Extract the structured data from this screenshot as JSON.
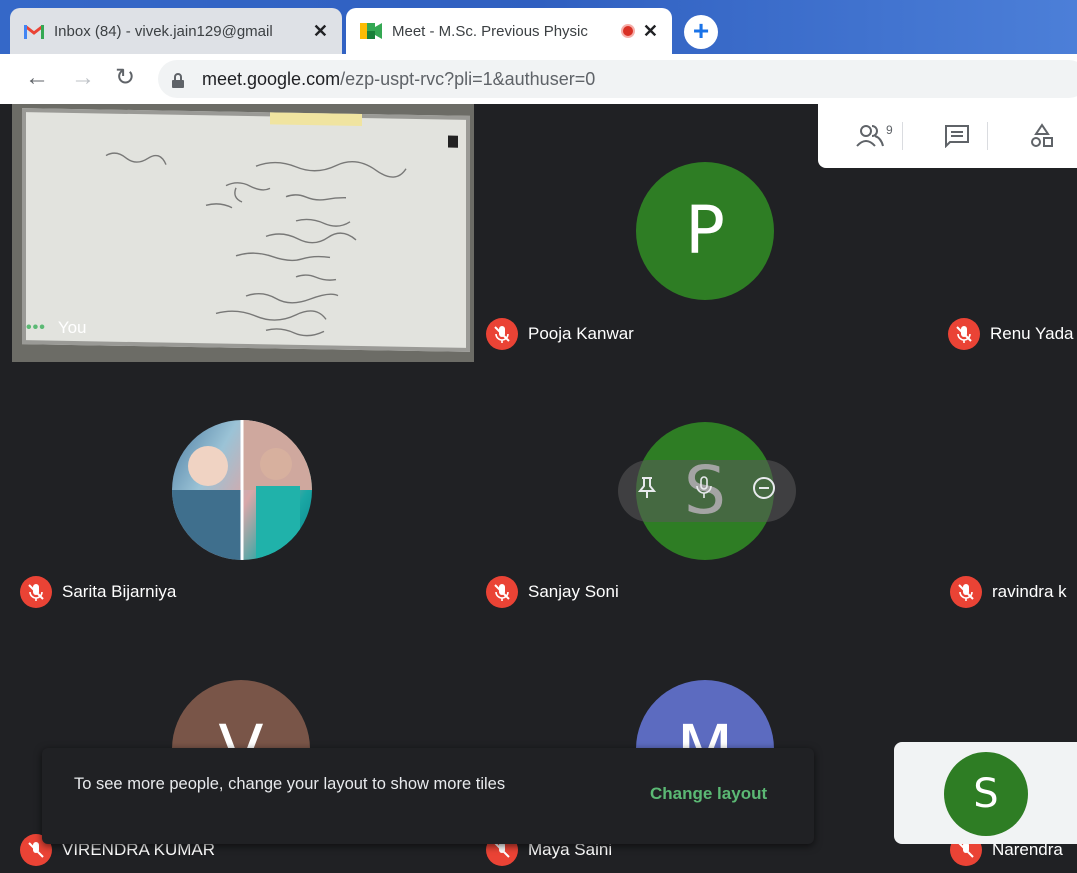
{
  "browser": {
    "tabs": [
      {
        "label": "Inbox (84) - vivek.jain129@gmail",
        "icon": "gmail-icon",
        "active": false
      },
      {
        "label": "Meet - M.Sc. Previous Physic",
        "icon": "meet-icon",
        "active": true,
        "recording": true
      }
    ],
    "new_tab_label": "+",
    "url_host": "meet.google.com",
    "url_path": "/ezp-uspt-rvc?pli=1&authuser=0"
  },
  "meet": {
    "participant_count": "9",
    "participants": [
      {
        "name": "You",
        "avatar_letter": "",
        "muted": false
      },
      {
        "name": "Pooja Kanwar",
        "avatar_letter": "P",
        "muted": true,
        "color": "#2e7d24"
      },
      {
        "name": "Renu Yada",
        "avatar_letter": "",
        "muted": true
      },
      {
        "name": "Sarita Bijarniya",
        "avatar_letter": "",
        "muted": true
      },
      {
        "name": "Sanjay Soni",
        "avatar_letter": "S",
        "muted": true,
        "color": "#2e7d24"
      },
      {
        "name": "ravindra k",
        "avatar_letter": "",
        "muted": true
      },
      {
        "name": "VIRENDRA KUMAR",
        "avatar_letter": "V",
        "muted": true,
        "color": "#795548"
      },
      {
        "name": "Maya Saini",
        "avatar_letter": "M",
        "muted": true,
        "color": "#5c6bc0"
      },
      {
        "name": "Narendra",
        "avatar_letter": "S",
        "muted": true,
        "color": "#2e7d24"
      }
    ],
    "toast": {
      "message": "To see more people, change your layout to show more tiles",
      "action": "Change layout"
    },
    "accent": "#5bb974"
  }
}
